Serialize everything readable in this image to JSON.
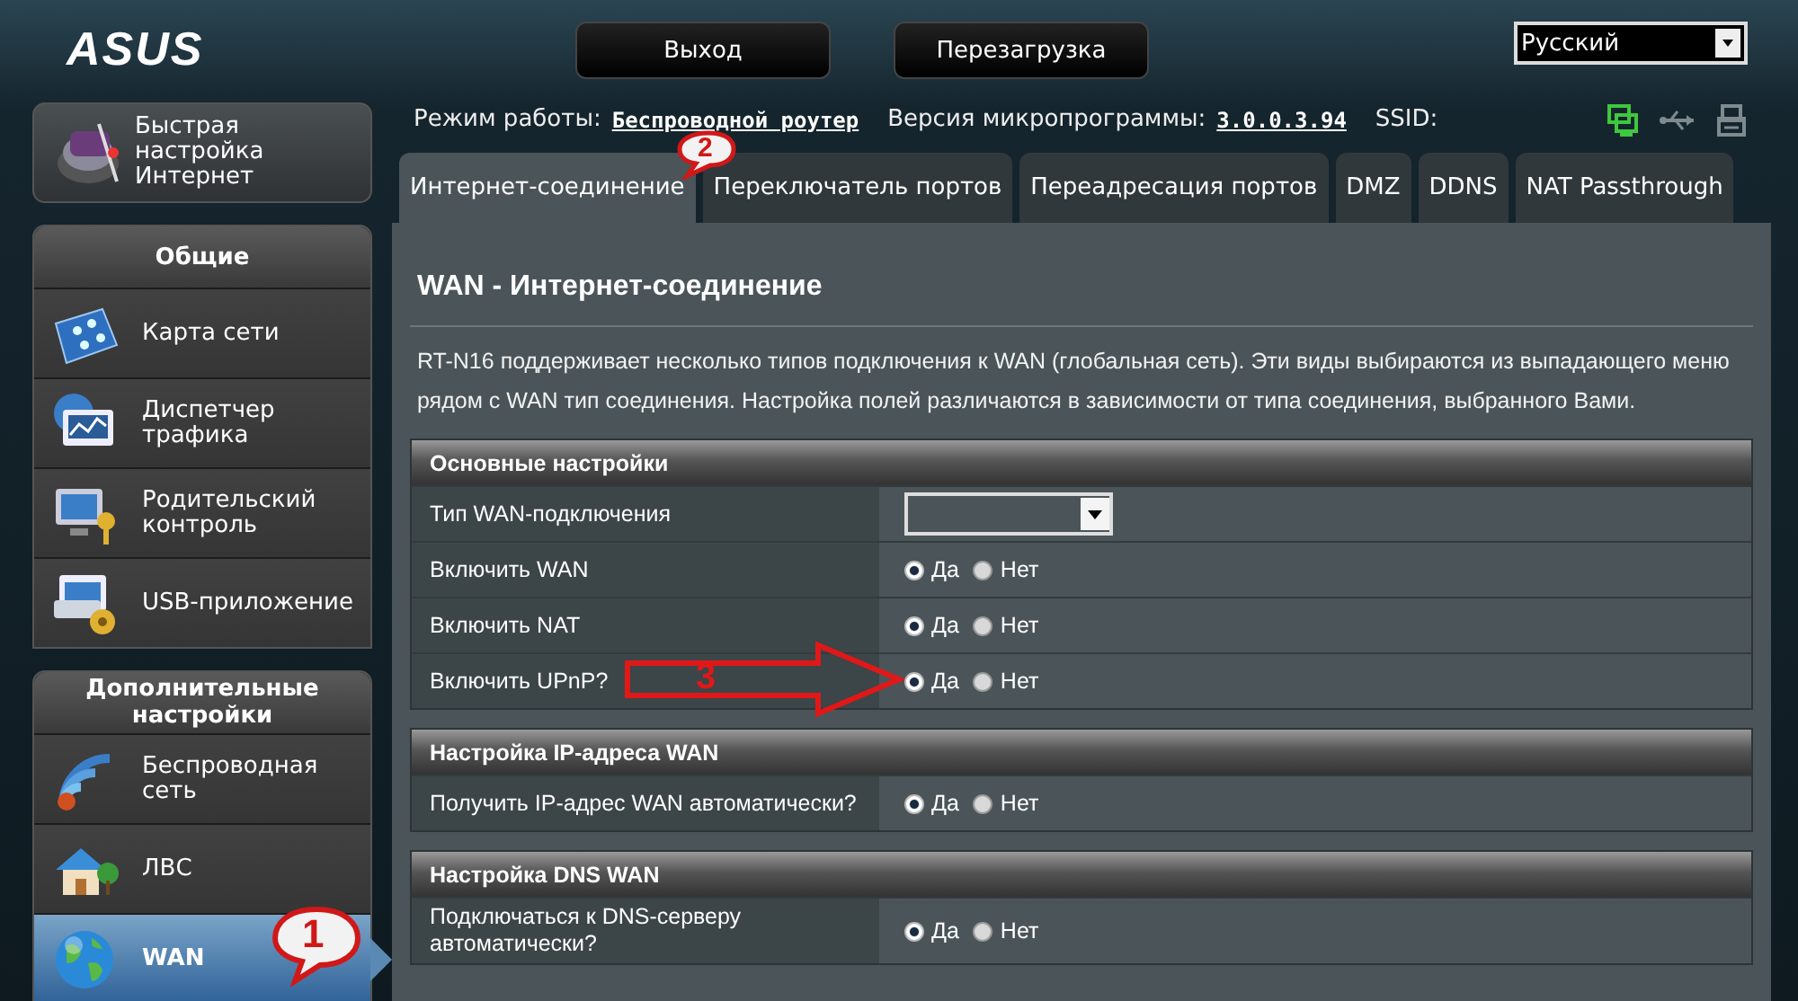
{
  "header": {
    "logo": "ASUS",
    "buttons": [
      "Выход",
      "Перезагрузка"
    ],
    "language": {
      "value": "Русский"
    }
  },
  "quick_setup": {
    "label": "Быстрая\nнастройка\nИнтернет"
  },
  "sidebar": {
    "groups": [
      {
        "title": "Общие",
        "items": [
          {
            "label": "Карта сети",
            "selected": false
          },
          {
            "label": "Диспетчер\nтрафика",
            "selected": false
          },
          {
            "label": "Родительский\nконтроль",
            "selected": false
          },
          {
            "label": "USB-приложение",
            "selected": false
          }
        ]
      },
      {
        "title": "Дополнительные\nнастройки",
        "items": [
          {
            "label": "Беспроводная\nсеть",
            "selected": false
          },
          {
            "label": "ЛВС",
            "selected": false
          },
          {
            "label": "WAN",
            "selected": true,
            "callout": "1"
          }
        ]
      }
    ]
  },
  "info": {
    "mode_label": "Режим работы:",
    "mode_value": "Беспроводной роутер",
    "firmware_label": "Версия микропрограммы:",
    "firmware_value": "3.0.0.3.94",
    "ssid_label": "SSID:"
  },
  "status_icons": [
    {
      "kind": "network",
      "active": true
    },
    {
      "kind": "usb",
      "active": false
    },
    {
      "kind": "printer",
      "active": false
    }
  ],
  "tabs": [
    {
      "label": "Интернет-соединение",
      "selected": true,
      "callout": "2"
    },
    {
      "label": "Переключатель портов",
      "selected": false
    },
    {
      "label": "Переадресация портов",
      "selected": false
    },
    {
      "label": "DMZ",
      "selected": false
    },
    {
      "label": "DDNS",
      "selected": false
    },
    {
      "label": "NAT Passthrough",
      "selected": false
    }
  ],
  "page": {
    "title": "WAN - Интернет-соединение",
    "description": "RT-N16 поддерживает несколько типов подключения к WAN (глобальная сеть). Эти виды выбираются из выпадающего меню\nрядом с WAN тип соединения. Настройка полей различаются в зависимости от типа соединения, выбранного Вами."
  },
  "sections": [
    {
      "title": "Основные настройки",
      "rows": [
        {
          "kind": "select",
          "label": "Тип WAN-подключения"
        },
        {
          "kind": "radio",
          "label": "Включить WAN",
          "options": [
            {
              "label": "Да",
              "selected": true
            },
            {
              "label": "Нет",
              "selected": false
            }
          ]
        },
        {
          "kind": "radio",
          "label": "Включить NAT",
          "options": [
            {
              "label": "Да",
              "selected": true
            },
            {
              "label": "Нет",
              "selected": false
            }
          ]
        },
        {
          "kind": "radio",
          "label": "Включить UPnP?",
          "callout": "3",
          "options": [
            {
              "label": "Да",
              "selected": true
            },
            {
              "label": "Нет",
              "selected": false
            }
          ]
        }
      ]
    },
    {
      "title": "Настройка IP-адреса WAN",
      "rows": [
        {
          "kind": "radio",
          "label": "Получить IP-адрес WAN автоматически?",
          "options": [
            {
              "label": "Да",
              "selected": true
            },
            {
              "label": "Нет",
              "selected": false
            }
          ]
        }
      ]
    },
    {
      "title": "Настройка DNS WAN",
      "rows": [
        {
          "kind": "radio",
          "label": "Подключаться к DNS-серверу\nавтоматически?",
          "options": [
            {
              "label": "Да",
              "selected": true
            },
            {
              "label": "Нет",
              "selected": false
            }
          ]
        }
      ]
    }
  ]
}
